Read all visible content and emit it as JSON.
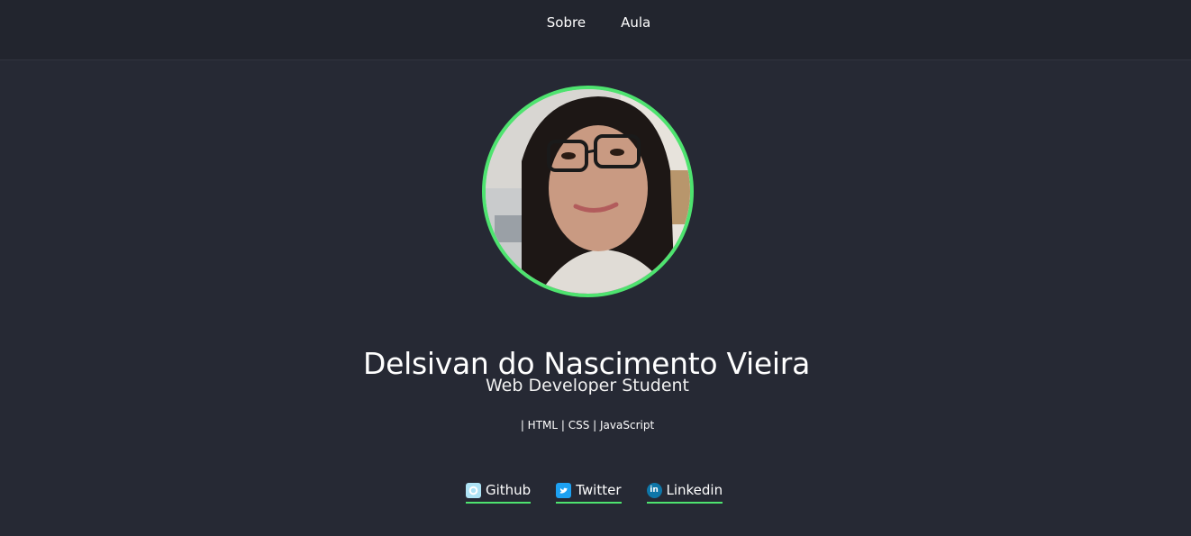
{
  "nav": {
    "items": [
      {
        "label": "Sobre"
      },
      {
        "label": "Aula"
      }
    ]
  },
  "profile": {
    "name": "Delsivan do Nascimento Vieira",
    "role": "Web Developer Student",
    "skills": "| HTML | CSS | JavaScript"
  },
  "social": [
    {
      "label": "Github",
      "icon": "github-icon"
    },
    {
      "label": "Twitter",
      "icon": "twitter-icon"
    },
    {
      "label": "Linkedin",
      "icon": "linkedin-icon"
    }
  ],
  "colors": {
    "background": "#262934",
    "navbar": "#22252e",
    "accent": "#4ee36f"
  }
}
